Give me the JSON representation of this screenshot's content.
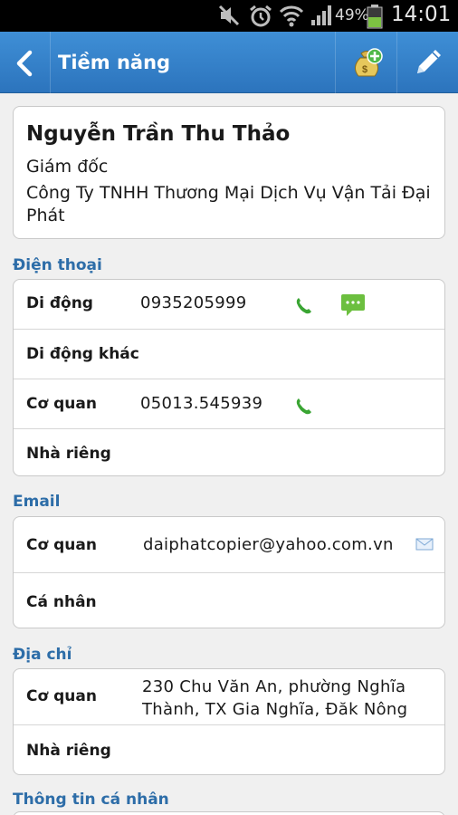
{
  "status_bar": {
    "battery_percent": "49%",
    "time": "14:01",
    "icons": [
      "mute-icon",
      "alarm-icon",
      "wifi-icon",
      "signal-icon",
      "battery-icon"
    ]
  },
  "action_bar": {
    "title": "Tiềm năng",
    "back_icon": "chevron-left-icon",
    "convert_icon": "money-bag-add-icon",
    "edit_icon": "pencil-icon"
  },
  "contact": {
    "name": "Nguyễn Trần Thu Thảo",
    "position": "Giám đốc",
    "company": "Công Ty TNHH Thương Mại Dịch Vụ Vận Tải Đại Phát"
  },
  "phone": {
    "section_title": "Điện thoại",
    "rows": [
      {
        "label": "Di động",
        "value": "0935205999"
      },
      {
        "label": "Di động khác",
        "value": ""
      },
      {
        "label": "Cơ quan",
        "value": "05013.545939"
      },
      {
        "label": "Nhà riêng",
        "value": ""
      }
    ]
  },
  "email": {
    "section_title": "Email",
    "rows": [
      {
        "label": "Cơ quan",
        "value": "daiphatcopier@yahoo.com.vn"
      },
      {
        "label": "Cá nhân",
        "value": ""
      }
    ]
  },
  "address": {
    "section_title": "Địa chỉ",
    "rows": [
      {
        "label": "Cơ quan",
        "value": "230 Chu Văn An, phường Nghĩa Thành, TX Gia Nghĩa, Đăk Nông"
      },
      {
        "label": "Nhà riêng",
        "value": ""
      }
    ]
  },
  "personal": {
    "section_title": "Thông tin cá nhân"
  },
  "colors": {
    "action_bar": "#3584cc",
    "section_title": "#2d6da8",
    "call_green": "#3aa533",
    "sms_green": "#6cbf3f"
  }
}
